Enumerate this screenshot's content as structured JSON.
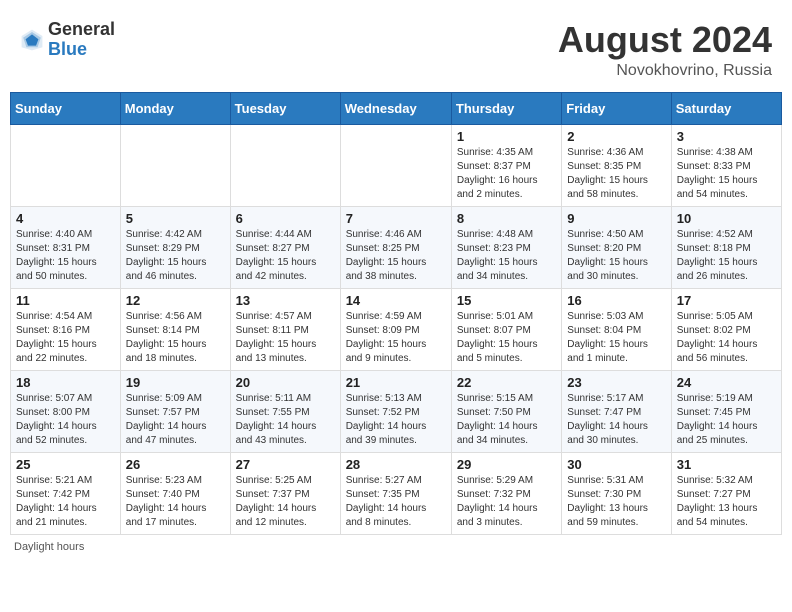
{
  "logo": {
    "text_general": "General",
    "text_blue": "Blue"
  },
  "title": {
    "month_year": "August 2024",
    "location": "Novokhovrino, Russia"
  },
  "days_of_week": [
    "Sunday",
    "Monday",
    "Tuesday",
    "Wednesday",
    "Thursday",
    "Friday",
    "Saturday"
  ],
  "footer": {
    "daylight_hours_label": "Daylight hours"
  },
  "weeks": [
    [
      {
        "day": "",
        "info": ""
      },
      {
        "day": "",
        "info": ""
      },
      {
        "day": "",
        "info": ""
      },
      {
        "day": "",
        "info": ""
      },
      {
        "day": "1",
        "info": "Sunrise: 4:35 AM\nSunset: 8:37 PM\nDaylight: 16 hours\nand 2 minutes."
      },
      {
        "day": "2",
        "info": "Sunrise: 4:36 AM\nSunset: 8:35 PM\nDaylight: 15 hours\nand 58 minutes."
      },
      {
        "day": "3",
        "info": "Sunrise: 4:38 AM\nSunset: 8:33 PM\nDaylight: 15 hours\nand 54 minutes."
      }
    ],
    [
      {
        "day": "4",
        "info": "Sunrise: 4:40 AM\nSunset: 8:31 PM\nDaylight: 15 hours\nand 50 minutes."
      },
      {
        "day": "5",
        "info": "Sunrise: 4:42 AM\nSunset: 8:29 PM\nDaylight: 15 hours\nand 46 minutes."
      },
      {
        "day": "6",
        "info": "Sunrise: 4:44 AM\nSunset: 8:27 PM\nDaylight: 15 hours\nand 42 minutes."
      },
      {
        "day": "7",
        "info": "Sunrise: 4:46 AM\nSunset: 8:25 PM\nDaylight: 15 hours\nand 38 minutes."
      },
      {
        "day": "8",
        "info": "Sunrise: 4:48 AM\nSunset: 8:23 PM\nDaylight: 15 hours\nand 34 minutes."
      },
      {
        "day": "9",
        "info": "Sunrise: 4:50 AM\nSunset: 8:20 PM\nDaylight: 15 hours\nand 30 minutes."
      },
      {
        "day": "10",
        "info": "Sunrise: 4:52 AM\nSunset: 8:18 PM\nDaylight: 15 hours\nand 26 minutes."
      }
    ],
    [
      {
        "day": "11",
        "info": "Sunrise: 4:54 AM\nSunset: 8:16 PM\nDaylight: 15 hours\nand 22 minutes."
      },
      {
        "day": "12",
        "info": "Sunrise: 4:56 AM\nSunset: 8:14 PM\nDaylight: 15 hours\nand 18 minutes."
      },
      {
        "day": "13",
        "info": "Sunrise: 4:57 AM\nSunset: 8:11 PM\nDaylight: 15 hours\nand 13 minutes."
      },
      {
        "day": "14",
        "info": "Sunrise: 4:59 AM\nSunset: 8:09 PM\nDaylight: 15 hours\nand 9 minutes."
      },
      {
        "day": "15",
        "info": "Sunrise: 5:01 AM\nSunset: 8:07 PM\nDaylight: 15 hours\nand 5 minutes."
      },
      {
        "day": "16",
        "info": "Sunrise: 5:03 AM\nSunset: 8:04 PM\nDaylight: 15 hours\nand 1 minute."
      },
      {
        "day": "17",
        "info": "Sunrise: 5:05 AM\nSunset: 8:02 PM\nDaylight: 14 hours\nand 56 minutes."
      }
    ],
    [
      {
        "day": "18",
        "info": "Sunrise: 5:07 AM\nSunset: 8:00 PM\nDaylight: 14 hours\nand 52 minutes."
      },
      {
        "day": "19",
        "info": "Sunrise: 5:09 AM\nSunset: 7:57 PM\nDaylight: 14 hours\nand 47 minutes."
      },
      {
        "day": "20",
        "info": "Sunrise: 5:11 AM\nSunset: 7:55 PM\nDaylight: 14 hours\nand 43 minutes."
      },
      {
        "day": "21",
        "info": "Sunrise: 5:13 AM\nSunset: 7:52 PM\nDaylight: 14 hours\nand 39 minutes."
      },
      {
        "day": "22",
        "info": "Sunrise: 5:15 AM\nSunset: 7:50 PM\nDaylight: 14 hours\nand 34 minutes."
      },
      {
        "day": "23",
        "info": "Sunrise: 5:17 AM\nSunset: 7:47 PM\nDaylight: 14 hours\nand 30 minutes."
      },
      {
        "day": "24",
        "info": "Sunrise: 5:19 AM\nSunset: 7:45 PM\nDaylight: 14 hours\nand 25 minutes."
      }
    ],
    [
      {
        "day": "25",
        "info": "Sunrise: 5:21 AM\nSunset: 7:42 PM\nDaylight: 14 hours\nand 21 minutes."
      },
      {
        "day": "26",
        "info": "Sunrise: 5:23 AM\nSunset: 7:40 PM\nDaylight: 14 hours\nand 17 minutes."
      },
      {
        "day": "27",
        "info": "Sunrise: 5:25 AM\nSunset: 7:37 PM\nDaylight: 14 hours\nand 12 minutes."
      },
      {
        "day": "28",
        "info": "Sunrise: 5:27 AM\nSunset: 7:35 PM\nDaylight: 14 hours\nand 8 minutes."
      },
      {
        "day": "29",
        "info": "Sunrise: 5:29 AM\nSunset: 7:32 PM\nDaylight: 14 hours\nand 3 minutes."
      },
      {
        "day": "30",
        "info": "Sunrise: 5:31 AM\nSunset: 7:30 PM\nDaylight: 13 hours\nand 59 minutes."
      },
      {
        "day": "31",
        "info": "Sunrise: 5:32 AM\nSunset: 7:27 PM\nDaylight: 13 hours\nand 54 minutes."
      }
    ]
  ]
}
